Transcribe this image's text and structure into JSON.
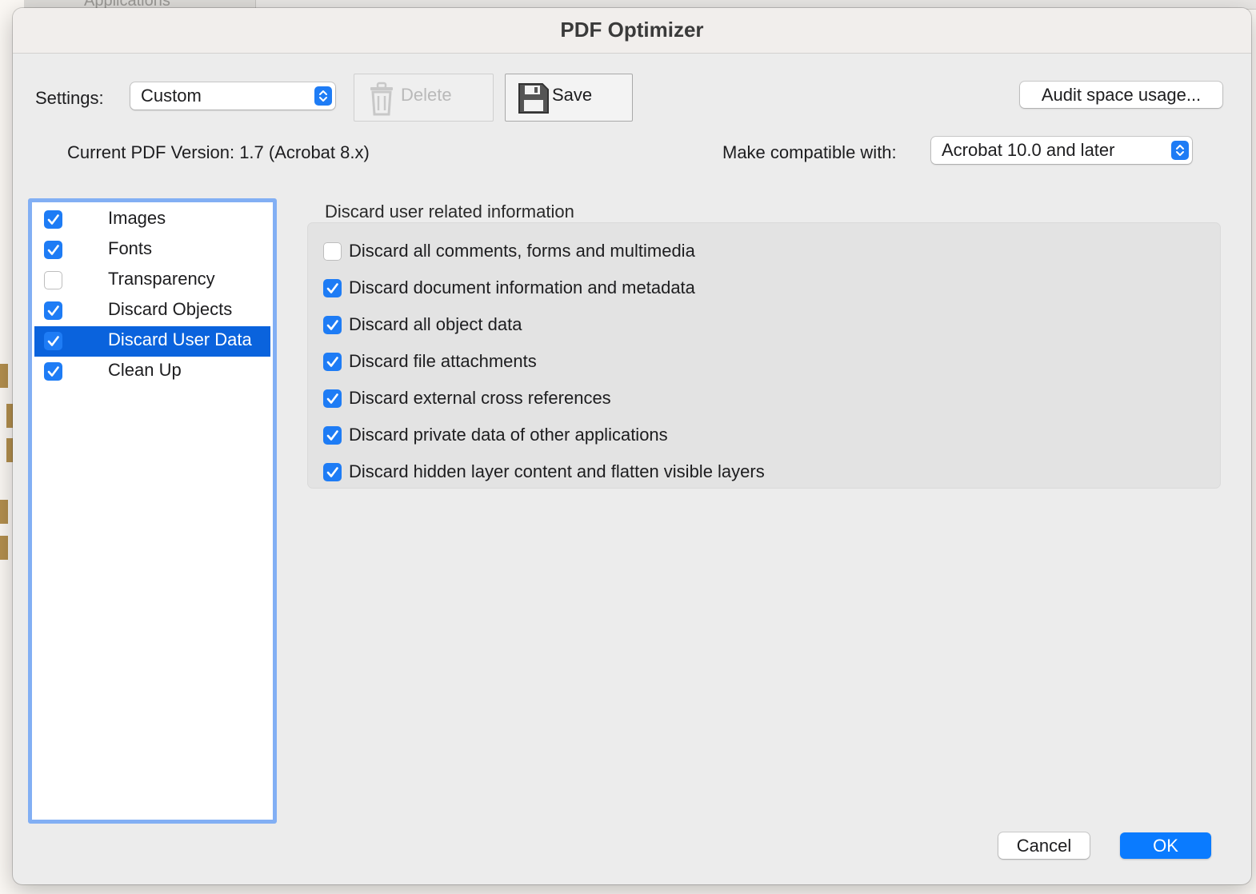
{
  "background": {
    "finder_label": "Applications"
  },
  "dialog": {
    "title": "PDF Optimizer",
    "settings": {
      "label": "Settings:",
      "value": "Custom",
      "delete_label": "Delete",
      "save_label": "Save",
      "audit_label": "Audit space usage..."
    },
    "current_version_text": "Current PDF Version: 1.7 (Acrobat 8.x)",
    "compat": {
      "label": "Make compatible with:",
      "value": "Acrobat 10.0 and later"
    },
    "categories": [
      {
        "label": "Images",
        "checked": true,
        "selected": false
      },
      {
        "label": "Fonts",
        "checked": true,
        "selected": false
      },
      {
        "label": "Transparency",
        "checked": false,
        "selected": false
      },
      {
        "label": "Discard Objects",
        "checked": true,
        "selected": false
      },
      {
        "label": "Discard User Data",
        "checked": true,
        "selected": true
      },
      {
        "label": "Clean Up",
        "checked": true,
        "selected": false
      }
    ],
    "panel": {
      "title": "Discard user related information",
      "options": [
        {
          "label": "Discard all comments, forms and multimedia",
          "checked": false
        },
        {
          "label": "Discard document information and metadata",
          "checked": true
        },
        {
          "label": "Discard all object data",
          "checked": true
        },
        {
          "label": "Discard file attachments",
          "checked": true
        },
        {
          "label": "Discard external cross references",
          "checked": true
        },
        {
          "label": "Discard private data of other applications",
          "checked": true
        },
        {
          "label": "Discard hidden layer content and flatten visible layers",
          "checked": true
        }
      ]
    },
    "buttons": {
      "cancel_label": "Cancel",
      "ok_label": "OK"
    }
  },
  "colors": {
    "accent": "#1e7cf5",
    "selection": "#0a63dd",
    "list_focus_ring": "#82aff4",
    "ok_button": "#0a7bff"
  },
  "icons": {
    "delete": "trash-icon",
    "save": "floppy-disk-icon",
    "popup": "up-down-chevron-icon",
    "check": "checkmark-icon"
  }
}
